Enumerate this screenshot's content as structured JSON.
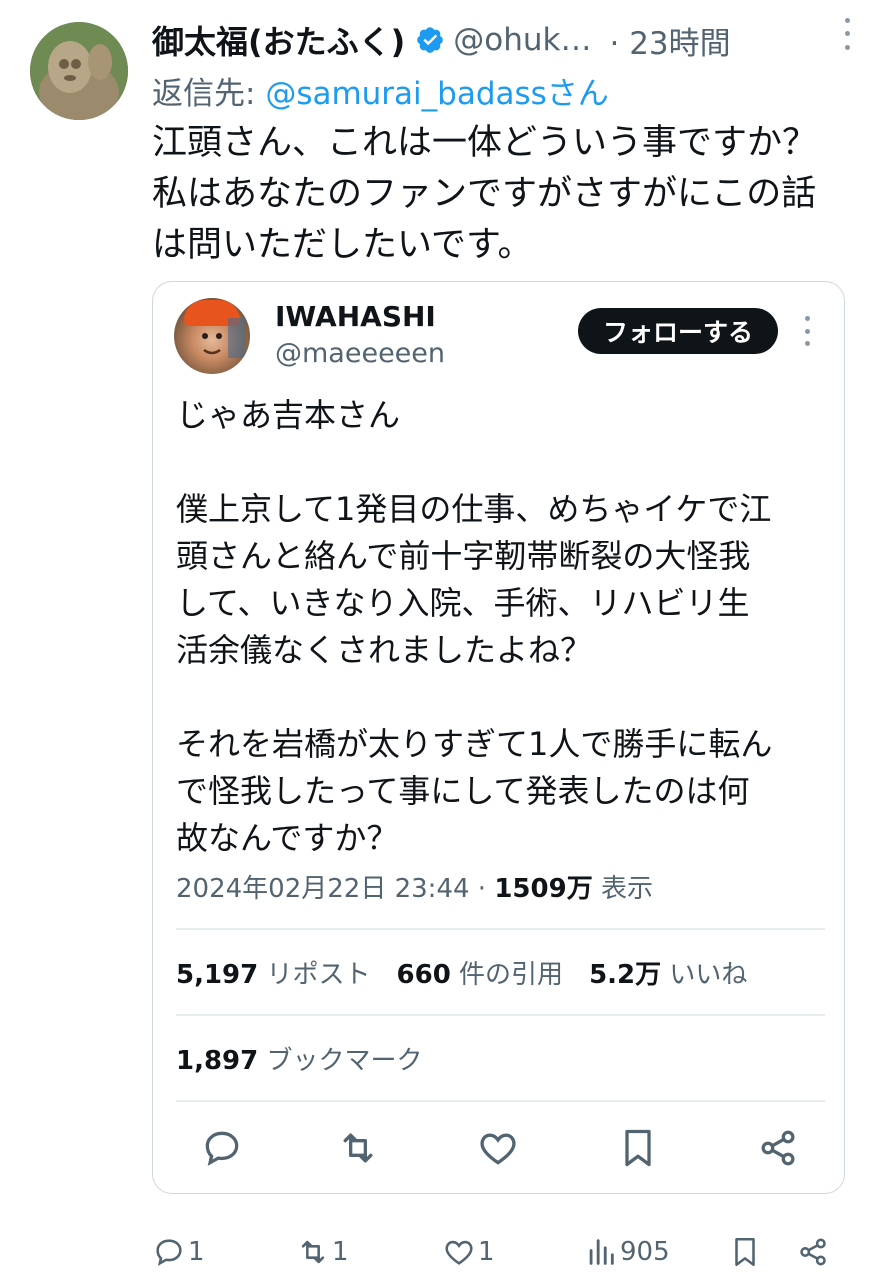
{
  "tweet": {
    "display_name": "御太福(おたふく)",
    "handle": "@ohuk…",
    "time": "· 23時間",
    "reply_prefix": "返信先: ",
    "reply_mention": "@samurai_badassさん",
    "text": "江頭さん、これは一体どういう事ですか？\n私はあなたのファンですがさすがにこの話\nは問いただしたいです。"
  },
  "quoted": {
    "display_name": "IWAHASHI",
    "handle": "@maeeeeen",
    "follow_label": "フォローする",
    "text": "じゃあ吉本さん\n\n僕上京して1発目の仕事、めちゃイケで江\n頭さんと絡んで前十字靭帯断裂の大怪我\nして、いきなり入院、手術、リハビリ生\n活余儀なくされましたよね？\n\nそれを岩橋が太りすぎて1人で勝手に転ん\nで怪我したって事にして発表したのは何\n故なんですか？",
    "timestamp": "2024年02月22日 23:44 · ",
    "views_count": "1509万",
    "views_label": " 表示",
    "reposts_count": "5,197",
    "reposts_label": " リポスト",
    "quotes_count": "660",
    "quotes_label": " 件の引用",
    "likes_count": "5.2万",
    "likes_label": " いいね",
    "bookmarks_count": "1,897",
    "bookmarks_label": " ブックマーク"
  },
  "footer": {
    "replies": "1",
    "reposts": "1",
    "likes": "1",
    "views": "905"
  },
  "colors": {
    "text": "#0f1419",
    "secondary": "#536471",
    "link": "#1d9bf0",
    "verified": "#1d9bf0",
    "border": "#cfd9de"
  }
}
